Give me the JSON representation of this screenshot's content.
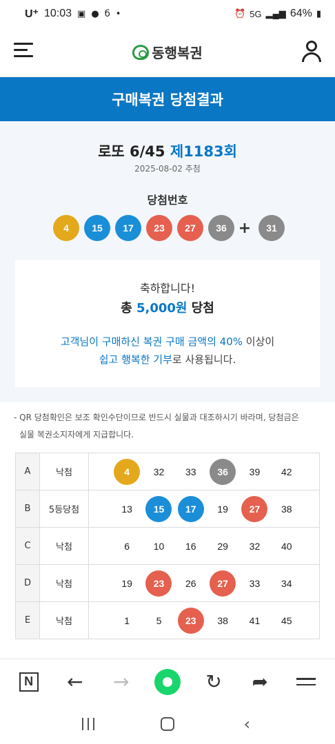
{
  "status_bar": {
    "carrier": "U⁺",
    "time": "10:03",
    "battery": "64%",
    "network": "5G"
  },
  "header": {
    "logo_text": "동행복권"
  },
  "title_band": "구매복권 당첨결과",
  "draw": {
    "game": "로또 6/45",
    "round": "제1183회",
    "date": "2025-08-02 추첨",
    "win_label": "당첨번호",
    "numbers": [
      "4",
      "15",
      "17",
      "23",
      "27",
      "36"
    ],
    "number_colors": [
      "yellow",
      "blue",
      "blue",
      "red",
      "red",
      "gray"
    ],
    "bonus": "31",
    "bonus_color": "gray"
  },
  "result_card": {
    "congrats": "축하합니다!",
    "total_prefix": "총 ",
    "total_amount": "5,000원",
    "total_suffix": " 당첨",
    "donate_line1_blue": "고객님이 구매하신 복권 구매 금액의 40%",
    "donate_line1_rest": " 이상이",
    "donate_line2_blue": "쉽고 행복한 기부",
    "donate_line2_rest": "로 사용됩니다."
  },
  "notice": {
    "line1": "- QR 당첨확인은 보조 확인수단이므로 반드시 실물과 대조하시기 바라며, 당첨금은",
    "line2": "실물 복권소지자에게 지급합니다."
  },
  "tickets": [
    {
      "letter": "A",
      "result": "낙첨",
      "numbers": [
        "4",
        "32",
        "33",
        "36",
        "39",
        "42"
      ],
      "matched": [
        "yellow",
        "",
        "",
        "gray",
        "",
        ""
      ]
    },
    {
      "letter": "B",
      "result": "5등당첨",
      "numbers": [
        "13",
        "15",
        "17",
        "19",
        "27",
        "38"
      ],
      "matched": [
        "",
        "blue",
        "blue",
        "",
        "red",
        ""
      ]
    },
    {
      "letter": "C",
      "result": "낙첨",
      "numbers": [
        "6",
        "10",
        "16",
        "29",
        "32",
        "40"
      ],
      "matched": [
        "",
        "",
        "",
        "",
        "",
        ""
      ]
    },
    {
      "letter": "D",
      "result": "낙첨",
      "numbers": [
        "19",
        "23",
        "26",
        "27",
        "33",
        "34"
      ],
      "matched": [
        "",
        "red",
        "",
        "red",
        "",
        ""
      ]
    },
    {
      "letter": "E",
      "result": "낙첨",
      "numbers": [
        "1",
        "5",
        "23",
        "38",
        "41",
        "45"
      ],
      "matched": [
        "",
        "",
        "red",
        "",
        "",
        ""
      ]
    }
  ],
  "colors": {
    "brand_blue": "#0a77c5",
    "yellow": "#e3a81c",
    "blue": "#1b8ed8",
    "red": "#e5604f",
    "gray": "#8a8a8a",
    "logo_green": "#2b9b45"
  },
  "browser_bar_icons": [
    "naver-n-icon",
    "back-arrow-icon",
    "forward-arrow-icon",
    "green-home-icon",
    "refresh-icon",
    "share-icon",
    "menu-icon"
  ],
  "nav_bar_icons": [
    "recents-icon",
    "home-icon",
    "back-icon"
  ]
}
